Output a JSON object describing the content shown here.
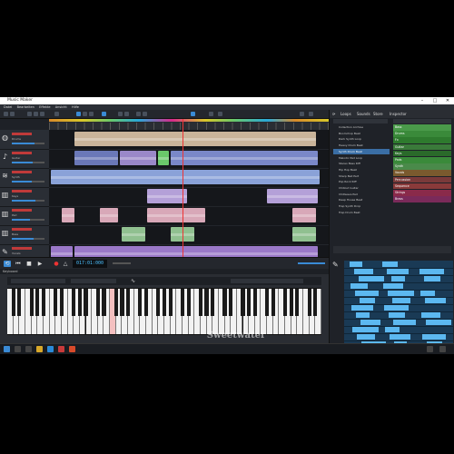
{
  "window": {
    "title": "Music Maker"
  },
  "menu": {
    "items": [
      "Datei",
      "Bearbeiten",
      "Effekte",
      "Ansicht",
      "Hilfe"
    ]
  },
  "tracks": [
    {
      "icon": "drums-icon",
      "name": "Drums",
      "color": "#c9b49a"
    },
    {
      "icon": "guitar-icon",
      "name": "Guitar",
      "color": "#7a88c8"
    },
    {
      "icon": "synth-icon",
      "name": "Synth",
      "color": "#8aa2d8"
    },
    {
      "icon": "piano-icon",
      "name": "Keys",
      "color": "#b4a0d8"
    },
    {
      "icon": "piano-icon",
      "name": "Pad",
      "color": "#d8a8b8"
    },
    {
      "icon": "piano-icon",
      "name": "Bass",
      "color": "#90c090"
    },
    {
      "icon": "mic-icon",
      "name": "Vocals",
      "color": "#9a78c8"
    }
  ],
  "transport": {
    "timecode": "017:01:000"
  },
  "keyboard": {
    "header": "Keyboard"
  },
  "rightpanel": {
    "tabs": [
      "Loops",
      "Sounds",
      "Store",
      "Inspector"
    ],
    "loops": [
      {
        "label": "Collection Archive"
      },
      {
        "label": "Boomchop Beat"
      },
      {
        "label": "Dark Synth Loop"
      },
      {
        "label": "Heavy Drum Beat"
      },
      {
        "label": "Synth Drum Beat"
      },
      {
        "label": "Melodic Pad Loop"
      },
      {
        "label": "Stereo Bass Riff"
      },
      {
        "label": "Hip Hop Beat"
      },
      {
        "label": "Sharp Bell Part"
      },
      {
        "label": "Pop Rock Riff"
      },
      {
        "label": "Chillout Guitar"
      },
      {
        "label": "Chillwave Pad"
      },
      {
        "label": "Deep House Beat"
      },
      {
        "label": "Trap Synth Drop"
      },
      {
        "label": "Trap Drum Beat"
      }
    ],
    "selected_index": 4,
    "categories": [
      {
        "label": "Bass",
        "color": "#4a9a4a"
      },
      {
        "label": "Drums",
        "color": "#3a8a3a"
      },
      {
        "label": "Fx",
        "color": "#2e7a2e"
      },
      {
        "label": "Guitar",
        "color": "#3a7a3a"
      },
      {
        "label": "Keys",
        "color": "#2a6a2a"
      },
      {
        "label": "Pads",
        "color": "#3a8a3a"
      },
      {
        "label": "Synth",
        "color": "#4a8a4a"
      },
      {
        "label": "Vocals",
        "color": "#7a5a2e"
      },
      {
        "label": "Percussion",
        "color": "#7a3a3a"
      },
      {
        "label": "Sequence",
        "color": "#8a3a3a"
      },
      {
        "label": "Strings",
        "color": "#8a2a4a"
      },
      {
        "label": "Brass",
        "color": "#7a2a5a"
      }
    ]
  },
  "watermark": "Sweetwater"
}
